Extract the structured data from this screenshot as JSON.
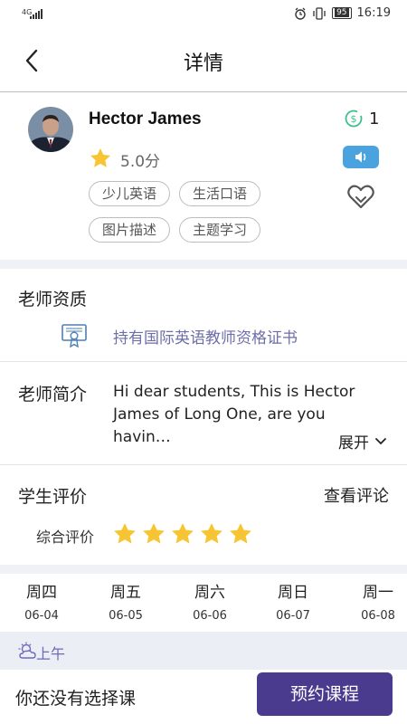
{
  "status_bar": {
    "network": "4G",
    "battery": "95",
    "time": "16:19"
  },
  "header": {
    "title": "详情"
  },
  "teacher": {
    "name": "Hector James",
    "rating": "5.0分",
    "coins": "1",
    "tags": [
      "少儿英语",
      "生活口语",
      "图片描述",
      "主题学习"
    ]
  },
  "qualification": {
    "title": "老师资质",
    "certificate": "持有国际英语教师资格证书"
  },
  "intro": {
    "title": "老师简介",
    "text_line1": "Hi dear students, This is Hector",
    "text_line2": "James of Long One, are you havin…",
    "expand_label": "展开"
  },
  "reviews": {
    "title": "学生评价",
    "view_label": "查看评论",
    "overall_label": "综合评价",
    "stars": 5
  },
  "schedule": {
    "days": [
      {
        "day": "周四",
        "date": "06-04"
      },
      {
        "day": "周五",
        "date": "06-05"
      },
      {
        "day": "周六",
        "date": "06-06"
      },
      {
        "day": "周日",
        "date": "06-07"
      },
      {
        "day": "周一",
        "date": "06-08"
      }
    ],
    "period_label": "上午"
  },
  "footer": {
    "status_text": "你还没有选择课",
    "book_label": "预约课程"
  },
  "colors": {
    "accent": "#4b3b8f",
    "star": "#f7c531",
    "audio": "#4aa3df",
    "link": "#6e6ea8"
  }
}
